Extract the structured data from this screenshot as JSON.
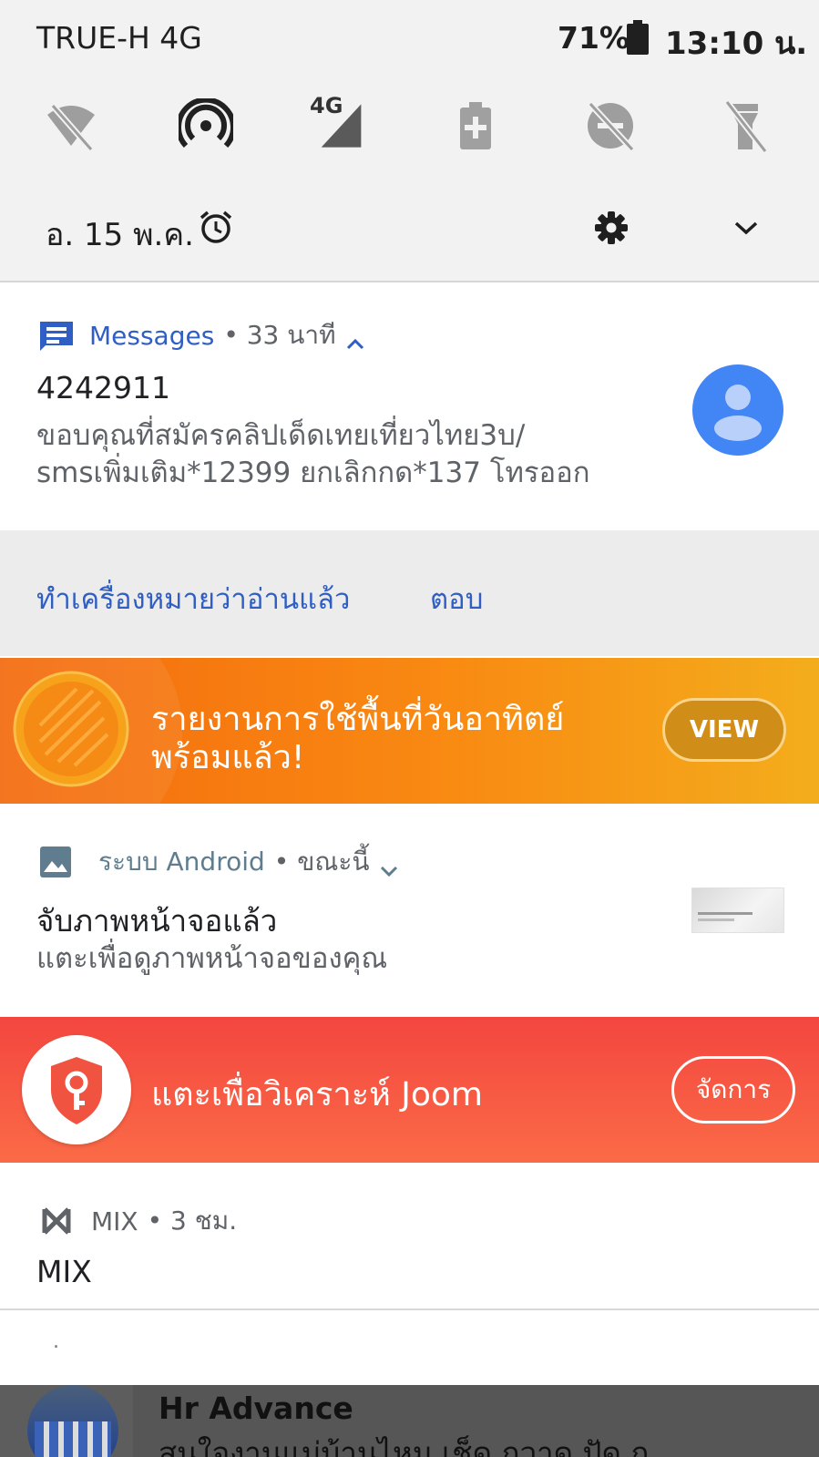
{
  "status_bar": {
    "carrier": "TRUE-H 4G",
    "battery": "71%",
    "time": "13:10 น."
  },
  "quick_settings": {
    "icons": [
      "wifi-off-icon",
      "hotspot-icon",
      "mobile-data-4g-icon",
      "battery-saver-icon",
      "do-not-disturb-off-icon",
      "flashlight-off-icon"
    ],
    "network_badge": "4G",
    "date": "อ. 15 พ.ค."
  },
  "messages_notification": {
    "app": "Messages",
    "meta": "• 33 นาที",
    "sender": "4242911",
    "body_line1": "ขอบคุณที่สมัครคลิปเด็ดเทยเที่ยวไทย3บ/",
    "body_line2": "smsเพิ่มเติม*12399 ยกเลิกกด*137 โทรออก",
    "action_mark_read": "ทำเครื่องหมายว่าอ่านแล้ว",
    "action_reply": "ตอบ",
    "accent": "#2f5ec4"
  },
  "storage_banner": {
    "text_line1": "รายงานการใช้พื้นที่วันอาทิตย์",
    "text_line2": "พร้อมแล้ว!",
    "button": "VIEW"
  },
  "screenshot_notification": {
    "app": "ระบบ Android",
    "meta": "• ขณะนี้",
    "title": "จับภาพหน้าจอแล้ว",
    "body": "แตะเพื่อดูภาพหน้าจอของคุณ"
  },
  "joom_banner": {
    "text": "แตะเพื่อวิเคราะห์ Joom",
    "button": "จัดการ"
  },
  "mix_notification": {
    "app": "MIX",
    "meta": "• 3 ชม.",
    "title": "MIX",
    "extra": "."
  },
  "hr_notification": {
    "title": "Hr Advance",
    "body": "สนใจงานแม่บ้านไหม เช็ด กวาด ปัด ถู"
  }
}
